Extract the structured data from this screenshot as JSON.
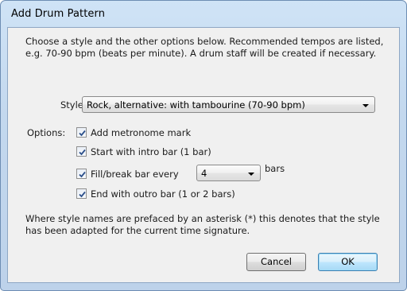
{
  "window": {
    "title": "Add Drum Pattern"
  },
  "intro": {
    "line1": "Choose a style and the other options below. Recommended tempos are listed,",
    "line2": "e.g. 70-90 bpm (beats per minute). A drum staff will be created if necessary."
  },
  "style": {
    "label": "Style:",
    "selected": "Rock, alternative: with tambourine (70-90 bpm)"
  },
  "options": {
    "label": "Options:",
    "metronome": {
      "label": "Add metronome mark",
      "checked": true
    },
    "intro_bar": {
      "label": "Start with intro bar (1 bar)",
      "checked": true
    },
    "fill": {
      "label": "Fill/break bar every",
      "checked": true,
      "value": "4",
      "unit": "bars"
    },
    "outro_bar": {
      "label": "End with outro bar (1 or 2 bars)",
      "checked": true
    }
  },
  "note": {
    "line1": "Where style names are prefaced by an asterisk (*) this denotes that the style",
    "line2": "has been adapted for the current time signature."
  },
  "buttons": {
    "cancel": "Cancel",
    "ok": "OK"
  }
}
